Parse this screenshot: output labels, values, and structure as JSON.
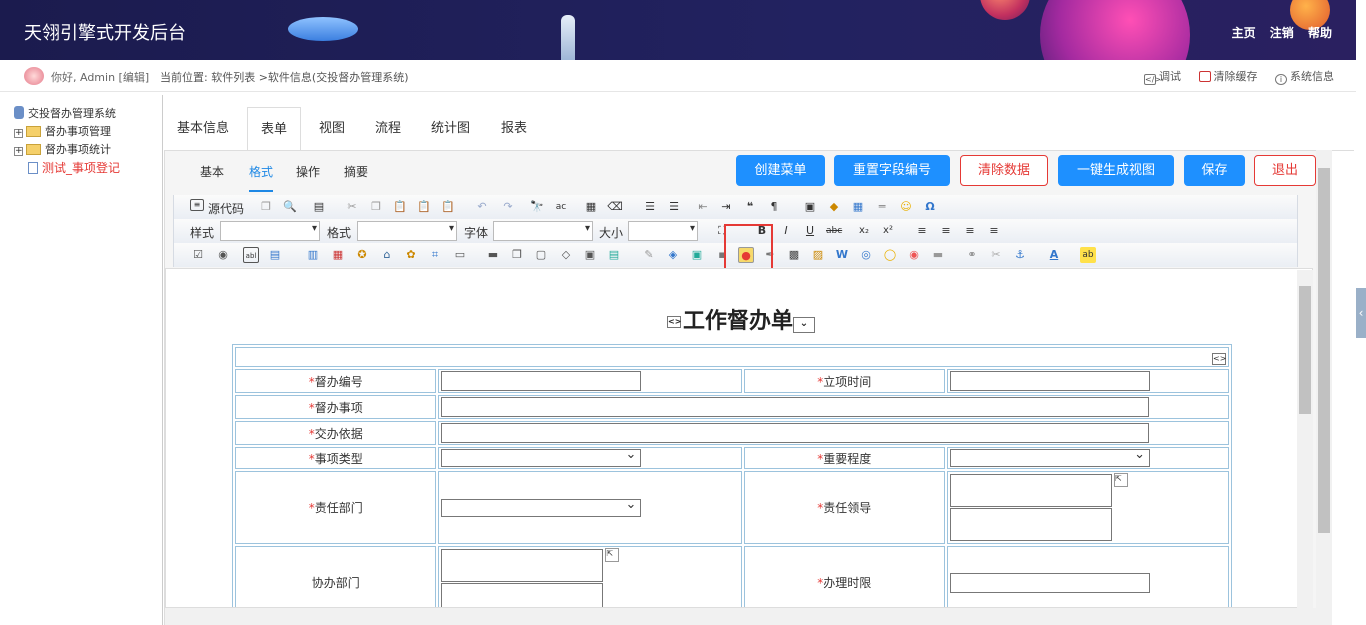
{
  "header": {
    "title": "天翎引擎式开发后台",
    "links": [
      "主页",
      "注销",
      "帮助"
    ]
  },
  "subbar": {
    "greeting": "你好, Admin [编辑]",
    "breadcrumb": "当前位置: 软件列表 >软件信息(交投督办管理系统)",
    "tools": [
      "调试",
      "清除缓存",
      "系统信息"
    ]
  },
  "tree": {
    "root": "交投督办管理系统",
    "items": [
      "督办事项管理",
      "督办事项统计",
      "测试_事项登记"
    ]
  },
  "tabs": [
    "基本信息",
    "表单",
    "视图",
    "流程",
    "统计图",
    "报表"
  ],
  "subtabs": [
    "基本",
    "格式",
    "操作",
    "摘要"
  ],
  "buttons": {
    "create_menu": "创建菜单",
    "reset_field": "重置字段编号",
    "clear_data": "清除数据",
    "gen_view": "一键生成视图",
    "save": "保存",
    "exit": "退出"
  },
  "toolbar": {
    "source": "源代码",
    "style": "样式",
    "format": "格式",
    "font": "字体",
    "size": "大小"
  },
  "form": {
    "title": "工作督办单",
    "fields": {
      "f1": "督办编号",
      "f2": "立项时间",
      "f3": "督办事项",
      "f4": "交办依据",
      "f5": "事项类型",
      "f6": "重要程度",
      "f7": "责任部门",
      "f8": "责任领导",
      "f9": "协办部门",
      "f10": "办理时限"
    }
  }
}
